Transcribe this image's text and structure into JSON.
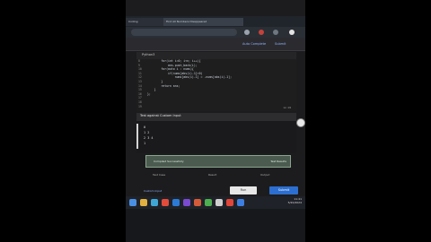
{
  "browser": {
    "tabs": [
      {
        "label": "Coding"
      },
      {
        "label": "Find All Numbers Disappeared"
      }
    ],
    "toolbar_icons": [
      "search-icon",
      "extension-icon",
      "profile-icon",
      "menu-icon"
    ]
  },
  "header": {
    "actions": [
      {
        "label": "Auto Complete"
      },
      {
        "label": "Submit"
      }
    ]
  },
  "editor": {
    "language": "Python3",
    "lines": [
      {
        "no": "8",
        "code": "        for(int i=0; i<n; i++){"
      },
      {
        "no": "9",
        "code": "            ans.push_back(i);"
      },
      {
        "no": "10",
        "code": "        for(auto i : nums){"
      },
      {
        "no": "11",
        "code": "            if(nums[abs(i)-1]>0)"
      },
      {
        "no": "12",
        "code": "                nums[abs(i)-1] = -nums[abs(i)-1];"
      },
      {
        "no": "13",
        "code": "        }"
      },
      {
        "no": "14",
        "code": "        return ans;"
      },
      {
        "no": "15",
        "code": "    }"
      },
      {
        "no": "16",
        "code": "};"
      },
      {
        "no": "17",
        "code": ""
      },
      {
        "no": "18",
        "code": ""
      },
      {
        "no": "19",
        "code": ""
      }
    ],
    "cursor_pos": "Ln 19"
  },
  "console": {
    "title": "Test against Custom Input",
    "output_lines": [
      "0",
      "1 2",
      "2 3 4",
      "1"
    ]
  },
  "result": {
    "status": "Compiled Successfully",
    "detail": "Test Results"
  },
  "footer": {
    "columns": [
      "Test Case",
      "Result",
      "Output"
    ],
    "link": "Custom Input",
    "run_label": "Run",
    "submit_label": "Submit"
  },
  "taskbar": {
    "time": "11:41",
    "date": "5/20/2024"
  }
}
